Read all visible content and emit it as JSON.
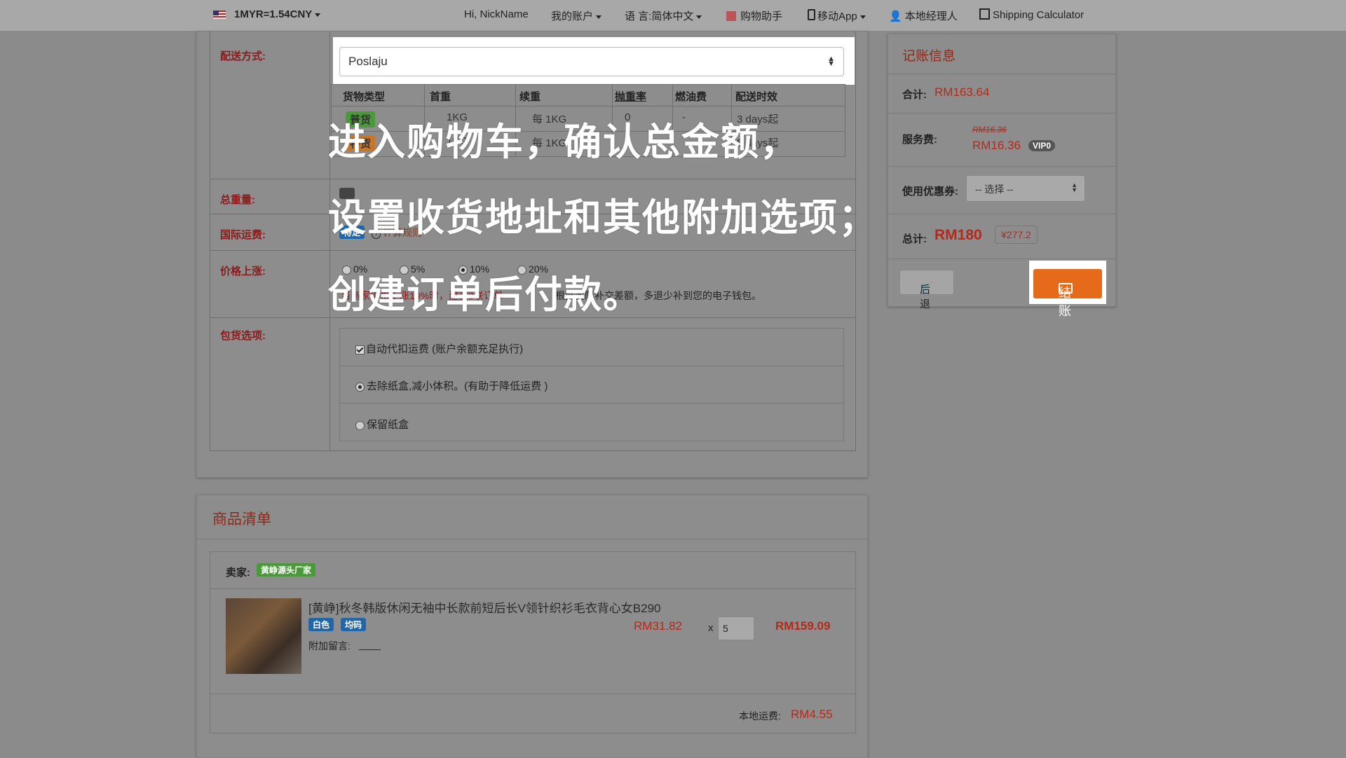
{
  "topbar": {
    "currency": "1MYR=1.54CNY",
    "greeting": "Hi, NickName",
    "account": "我的账户",
    "language": "语 言:简体中文",
    "shopping_assistant": "购物助手",
    "mobile_app": "移动App",
    "local_manager": "本地经理人",
    "shipping_calculator": "Shipping Calculator"
  },
  "form": {
    "delivery_label": "配送方式:",
    "delivery_value": "Poslaju",
    "table_headers": [
      "货物类型",
      "首重",
      "续重",
      "抛重率",
      "燃油费",
      "配送时效"
    ],
    "table_rows": [
      {
        "type": "普货",
        "first": "1KG",
        "cont": "每 1KG",
        "rate": "0",
        "fuel": "-",
        "time": "3 days起"
      },
      {
        "type": "特货",
        "first": "1KG",
        "cont": "每 1KG",
        "rate": "",
        "fuel": "",
        "time": "5 days起"
      }
    ],
    "total_weight_label": "总重量:",
    "intl_shipping_label": "国际运费:",
    "intl_shipping_badge": "待定",
    "calc_rule": "计算规则",
    "price_rise_label": "价格上涨:",
    "price_rise_options": [
      "0%",
      "5%",
      "10%",
      "20%"
    ],
    "price_rise_note_left": "当商家价格上涨10%时，建立3联订单",
    "price_rise_note_right": "根据实际补交差额，多退少补到您的电子钱包。",
    "package_label": "包货选项:",
    "package_options": [
      "自动代扣运费 (账户余额充足执行)",
      "去除纸盒,减小体积。(有助于降低运费 )",
      "保留纸盒"
    ]
  },
  "overlay_lines": [
    "进入购物车，确认总金额，",
    "设置收货地址和其他附加选项；",
    "创建订单后付款。"
  ],
  "billing": {
    "title": "记账信息",
    "subtotal_label": "合计:",
    "subtotal_value": "RM163.64",
    "service_label": "服务费:",
    "service_old": "RM16.36",
    "service_value": "RM16.36",
    "vip_badge": "VIP0",
    "coupon_label": "使用优惠券:",
    "coupon_placeholder": "-- 选择 --",
    "total_label": "总计:",
    "total_value": "RM180",
    "total_cny": "¥277.2",
    "back_button": "后退",
    "pay_button": "结账"
  },
  "goods": {
    "title": "商品清单",
    "seller_label": "卖家:",
    "seller_name": "黄峥源头厂家",
    "item_title": "[黄峥]秋冬韩版休闲无袖中长款前短后长V领针织衫毛衣背心女B290",
    "tag_color": "白色",
    "tag_size": "均码",
    "note_label": "附加留言:",
    "note_value": "____",
    "unit_price": "RM31.82",
    "qty_prefix": "x",
    "qty": "5",
    "line_total": "RM159.09",
    "local_shipping_label": "本地运费:",
    "local_shipping_value": "RM4.55"
  },
  "colors": {
    "accent_red": "#b32a1a",
    "pay_orange": "#e56a1a",
    "badge_blue": "#2266aa",
    "badge_green": "#4a9a3a"
  }
}
